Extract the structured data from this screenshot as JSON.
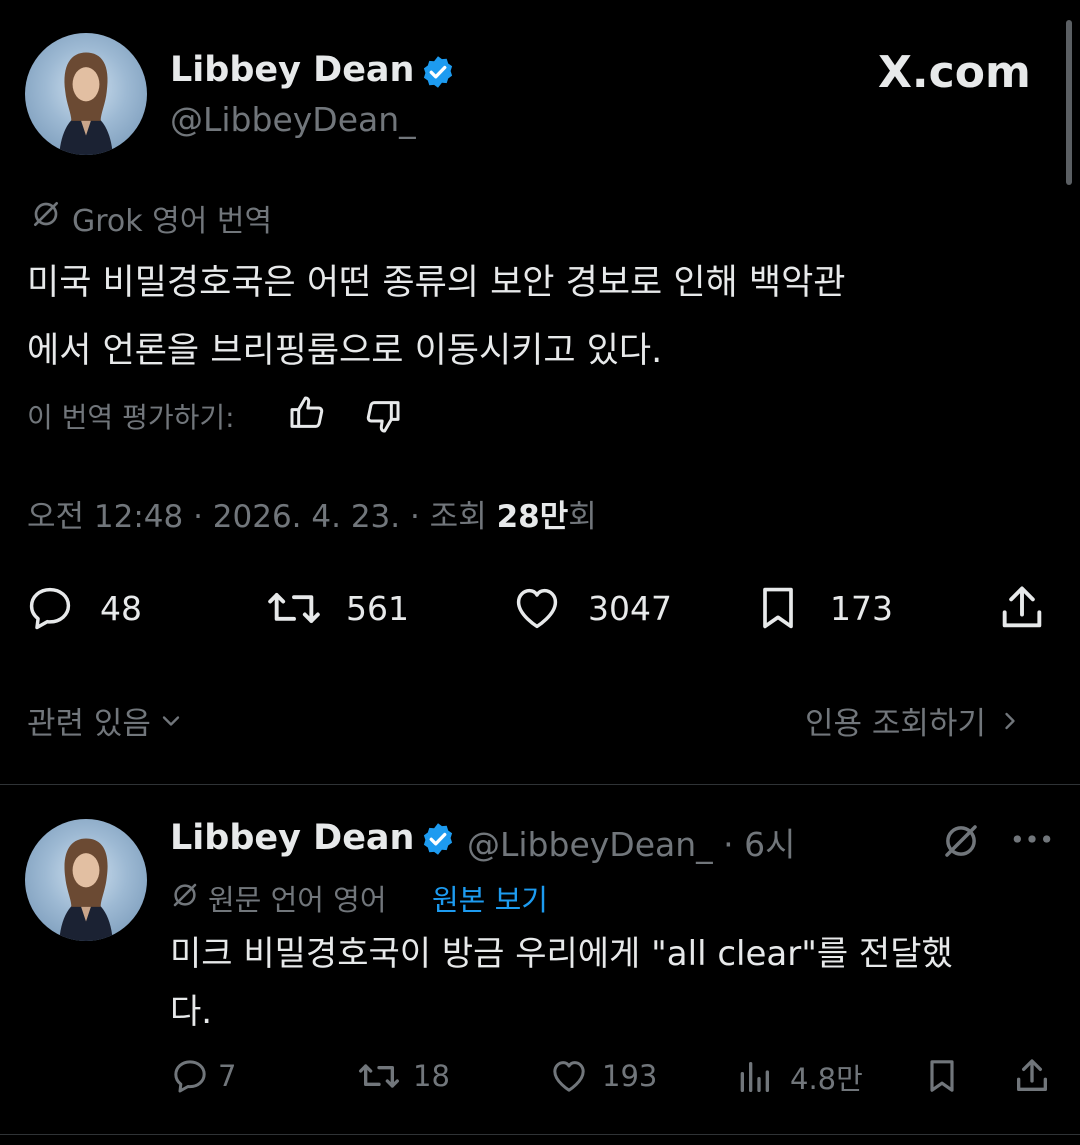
{
  "main_tweet": {
    "author_name": "Libbey Dean",
    "handle": "@LibbeyDean_",
    "brand": "X.com",
    "translation_label": "Grok 영어 번역",
    "text_line1": "미국 비밀경호국은 어떤 종류의 보안 경보로 인해 백악관",
    "text_line2": "에서 언론을 브리핑룸으로 이동시키고 있다.",
    "rate_label": "이 번역 평가하기:",
    "meta_time": "오전 12:48 · 2026. 4. 23. · 조회 ",
    "views_bold": "28만",
    "views_suffix": "회",
    "stats": {
      "replies": "48",
      "reposts": "561",
      "likes": "3047",
      "bookmarks": "173"
    },
    "related_label": "관련 있음",
    "quotes_label": "인용 조회하기"
  },
  "reply_tweet": {
    "author_name": "Libbey Dean",
    "handle_time": "@LibbeyDean_ · 6시",
    "translation_label": "원문 언어 영어",
    "show_original": "원본 보기",
    "text_line1": "미크 비밀경호국이 방금 우리에게 \"all clear\"를 전달했",
    "text_line2": "다.",
    "stats": {
      "replies": "7",
      "reposts": "18",
      "likes": "193",
      "views": "4.8만"
    }
  },
  "colors": {
    "background": "#000000",
    "text": "#e7e9ea",
    "muted": "#71767b",
    "accent": "#1d9bf0"
  },
  "icons": [
    "grok-icon",
    "verified-badge-icon",
    "thumbs-up-icon",
    "thumbs-down-icon",
    "reply-icon",
    "repost-icon",
    "like-icon",
    "bookmark-icon",
    "share-icon",
    "chevron-down-icon",
    "chevron-right-icon",
    "more-icon",
    "views-icon"
  ]
}
